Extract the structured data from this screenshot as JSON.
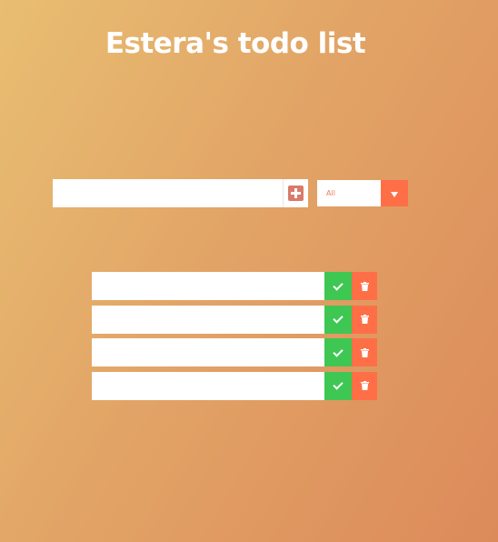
{
  "header": {
    "title": "Estera's todo list"
  },
  "add_form": {
    "input_value": "",
    "input_placeholder": "",
    "add_icon": "plus-square-icon"
  },
  "filter": {
    "selected": "All",
    "arrow_icon": "caret-down-icon"
  },
  "todos": [
    {
      "text": "",
      "complete_icon": "check-icon",
      "delete_icon": "trash-icon"
    },
    {
      "text": "",
      "complete_icon": "check-icon",
      "delete_icon": "trash-icon"
    },
    {
      "text": "",
      "complete_icon": "check-icon",
      "delete_icon": "trash-icon"
    },
    {
      "text": "",
      "complete_icon": "check-icon",
      "delete_icon": "trash-icon"
    }
  ],
  "colors": {
    "background_start": "#e8be72",
    "background_end": "#dc8a5a",
    "accent": "#ff6f47",
    "complete": "#3fc753",
    "add_icon": "#d97b6a"
  }
}
